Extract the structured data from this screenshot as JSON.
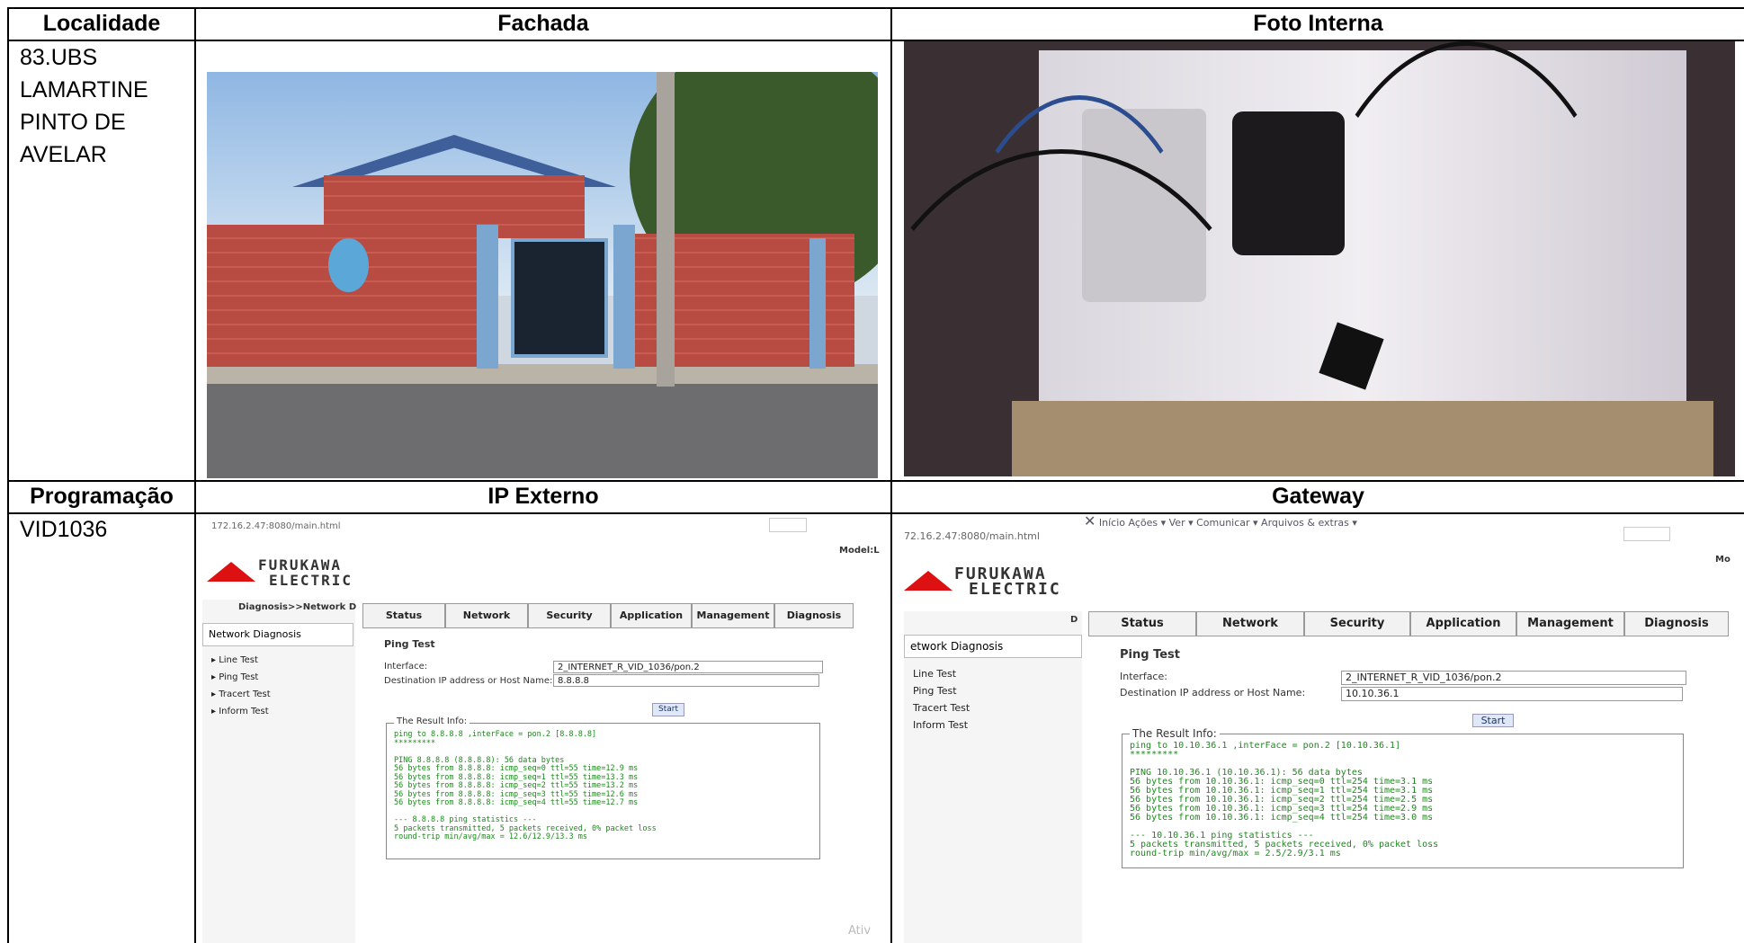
{
  "table": {
    "headers": {
      "localidade": "Localidade",
      "fachada": "Fachada",
      "foto_interna": "Foto Interna",
      "programacao": "Programação",
      "ip_externo": "IP Externo",
      "gateway": "Gateway"
    },
    "localidade_lines": [
      "83.UBS",
      "LAMARTINE",
      "PINTO DE",
      "AVELAR"
    ],
    "programacao_value": "VID1036"
  },
  "ip_externo_shot": {
    "url": "172.16.2.47:8080/main.html",
    "model": "Model:L",
    "logo_line1": "FURUKAWA",
    "logo_line2": "ELECTRIC",
    "breadcrumb": "Diagnosis>>Network D",
    "tabs": [
      "Status",
      "Network",
      "Security",
      "Application",
      "Management",
      "Diagnosis"
    ],
    "sidebar_title": "Network Diagnosis",
    "sidebar_items": [
      "Line Test",
      "Ping Test",
      "Tracert Test",
      "Inform Test"
    ],
    "section_title": "Ping Test",
    "interface_label": "Interface:",
    "interface_value": "2_INTERNET_R_VID_1036/pon.2",
    "dest_label": "Destination IP address or Host Name:",
    "dest_value": "8.8.8.8",
    "start_label": "Start",
    "result_title": "The Result Info:",
    "result_lines": [
      "ping to 8.8.8.8 ,interFace = pon.2 [8.8.8.8]",
      "*********",
      "",
      "PING 8.8.8.8 (8.8.8.8): 56 data bytes",
      "56 bytes from 8.8.8.8: icmp_seq=0 ttl=55 time=12.9 ms",
      "56 bytes from 8.8.8.8: icmp_seq=1 ttl=55 time=13.3 ms",
      "56 bytes from 8.8.8.8: icmp_seq=2 ttl=55 time=13.2 ms",
      "56 bytes from 8.8.8.8: icmp_seq=3 ttl=55 time=12.6 ms",
      "56 bytes from 8.8.8.8: icmp_seq=4 ttl=55 time=12.7 ms",
      "",
      "--- 8.8.8.8 ping statistics ---",
      "5 packets transmitted, 5 packets received, 0% packet loss",
      "round-trip min/avg/max = 12.6/12.9/13.3 ms"
    ],
    "watermark": "Ativ"
  },
  "gateway_shot": {
    "toolbar": "Início    Ações ▾    Ver ▾    Comunicar ▾    Arquivos & extras ▾",
    "url": "72.16.2.47:8080/main.html",
    "model": "Mo",
    "logo_line1": "FURUKAWA",
    "logo_line2": "ELECTRIC",
    "breadcrumb": "D",
    "tabs": [
      "Status",
      "Network",
      "Security",
      "Application",
      "Management",
      "Diagnosis"
    ],
    "sidebar_title": "etwork Diagnosis",
    "sidebar_items": [
      "Line Test",
      "Ping Test",
      "Tracert Test",
      "Inform Test"
    ],
    "section_title": "Ping Test",
    "interface_label": "Interface:",
    "interface_value": "2_INTERNET_R_VID_1036/pon.2",
    "dest_label": "Destination IP address or Host Name:",
    "dest_value": "10.10.36.1",
    "start_label": "Start",
    "result_title": "The Result Info:",
    "result_lines": [
      "ping to 10.10.36.1 ,interFace = pon.2 [10.10.36.1]",
      "*********",
      "",
      "PING 10.10.36.1 (10.10.36.1): 56 data bytes",
      "56 bytes from 10.10.36.1: icmp_seq=0 ttl=254 time=3.1 ms",
      "56 bytes from 10.10.36.1: icmp_seq=1 ttl=254 time=3.1 ms",
      "56 bytes from 10.10.36.1: icmp_seq=2 ttl=254 time=2.5 ms",
      "56 bytes from 10.10.36.1: icmp_seq=3 ttl=254 time=2.9 ms",
      "56 bytes from 10.10.36.1: icmp_seq=4 ttl=254 time=3.0 ms",
      "",
      "--- 10.10.36.1 ping statistics ---",
      "5 packets transmitted, 5 packets received, 0% packet loss",
      "round-trip min/avg/max = 2.5/2.9/3.1 ms"
    ]
  }
}
